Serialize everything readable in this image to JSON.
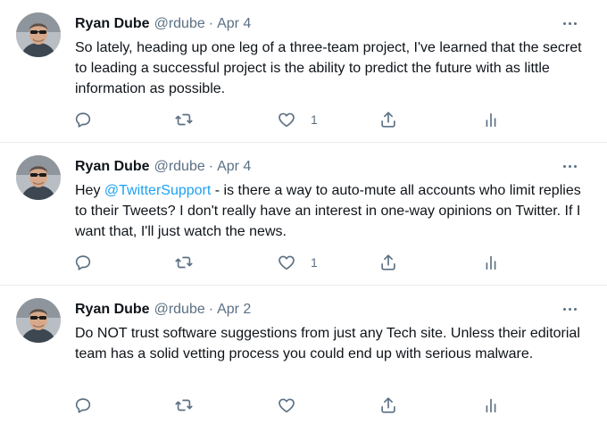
{
  "tweets": [
    {
      "name": "Ryan Dube",
      "handle": "@rdube",
      "separator": "·",
      "date": "Apr 4",
      "text": "So lately, heading up one leg of a three-team project, I've learned that the secret to leading a successful project is the ability to predict the future with as little information as possible.",
      "like_count": "1"
    },
    {
      "name": "Ryan Dube",
      "handle": "@rdube",
      "separator": "·",
      "date": "Apr 4",
      "text_before": "Hey ",
      "mention": "@TwitterSupport",
      "text_after": " - is there a way to auto-mute all accounts who limit replies to their Tweets? I don't really have an interest in one-way opinions on Twitter. If I want that, I'll just watch the news.",
      "like_count": "1"
    },
    {
      "name": "Ryan Dube",
      "handle": "@rdube",
      "separator": "·",
      "date": "Apr 2",
      "text": "Do NOT trust software suggestions from just any Tech site. Unless their editorial team has a solid vetting process you could end up with serious malware.",
      "like_count": ""
    }
  ],
  "icons": {
    "more": "more-horizontal-icon",
    "reply": "reply-icon",
    "retweet": "retweet-icon",
    "like": "heart-icon",
    "share": "share-icon",
    "analytics": "analytics-icon"
  },
  "colors": {
    "text": "#0f1419",
    "secondary": "#5b7083",
    "link": "#1da1f2",
    "divider": "#e6ecf0"
  }
}
